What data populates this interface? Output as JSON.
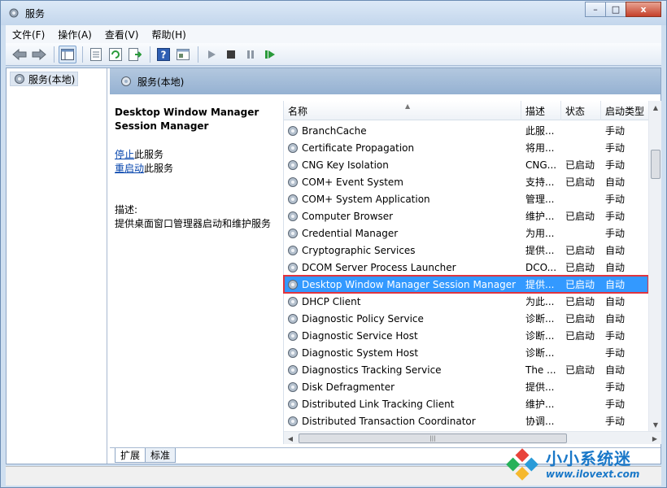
{
  "window": {
    "title": "服务",
    "controls": {
      "minimize": "–",
      "maximize": "□",
      "close": "x"
    }
  },
  "menu": [
    "文件(F)",
    "操作(A)",
    "查看(V)",
    "帮助(H)"
  ],
  "tree": {
    "root": "服务(本地)"
  },
  "pane": {
    "header": "服务(本地)",
    "selected_name": "Desktop Window Manager Session Manager",
    "stop_link": "停止",
    "stop_suffix": "此服务",
    "restart_link": "重启动",
    "restart_suffix": "此服务",
    "desc_label": "描述:",
    "desc_text": "提供桌面窗口管理器启动和维护服务"
  },
  "columns": {
    "name": "名称",
    "desc": "描述",
    "status": "状态",
    "startup": "启动类型"
  },
  "services": [
    {
      "name": "BranchCache",
      "desc": "此服...",
      "status": "",
      "startup": "手动"
    },
    {
      "name": "Certificate Propagation",
      "desc": "将用...",
      "status": "",
      "startup": "手动"
    },
    {
      "name": "CNG Key Isolation",
      "desc": "CNG...",
      "status": "已启动",
      "startup": "手动"
    },
    {
      "name": "COM+ Event System",
      "desc": "支持...",
      "status": "已启动",
      "startup": "自动"
    },
    {
      "name": "COM+ System Application",
      "desc": "管理...",
      "status": "",
      "startup": "手动"
    },
    {
      "name": "Computer Browser",
      "desc": "维护...",
      "status": "已启动",
      "startup": "手动"
    },
    {
      "name": "Credential Manager",
      "desc": "为用...",
      "status": "",
      "startup": "手动"
    },
    {
      "name": "Cryptographic Services",
      "desc": "提供...",
      "status": "已启动",
      "startup": "自动"
    },
    {
      "name": "DCOM Server Process Launcher",
      "desc": "DCO...",
      "status": "已启动",
      "startup": "自动"
    },
    {
      "name": "Desktop Window Manager Session Manager",
      "desc": "提供...",
      "status": "已启动",
      "startup": "自动",
      "selected": true
    },
    {
      "name": "DHCP Client",
      "desc": "为此...",
      "status": "已启动",
      "startup": "自动"
    },
    {
      "name": "Diagnostic Policy Service",
      "desc": "诊断...",
      "status": "已启动",
      "startup": "自动"
    },
    {
      "name": "Diagnostic Service Host",
      "desc": "诊断...",
      "status": "已启动",
      "startup": "手动"
    },
    {
      "name": "Diagnostic System Host",
      "desc": "诊断...",
      "status": "",
      "startup": "手动"
    },
    {
      "name": "Diagnostics Tracking Service",
      "desc": "The ...",
      "status": "已启动",
      "startup": "自动"
    },
    {
      "name": "Disk Defragmenter",
      "desc": "提供...",
      "status": "",
      "startup": "手动"
    },
    {
      "name": "Distributed Link Tracking Client",
      "desc": "维护...",
      "status": "",
      "startup": "手动"
    },
    {
      "name": "Distributed Transaction Coordinator",
      "desc": "协调...",
      "status": "",
      "startup": "手动"
    }
  ],
  "tabs": [
    "扩展",
    "标准"
  ],
  "watermark": {
    "cn": "小小系统迷",
    "url": "www.ilovext.com"
  },
  "colors": {
    "selection": "#3399ff",
    "highlight_box": "#e0343e",
    "link": "#0645ad",
    "watermark": "#1a78c8"
  }
}
